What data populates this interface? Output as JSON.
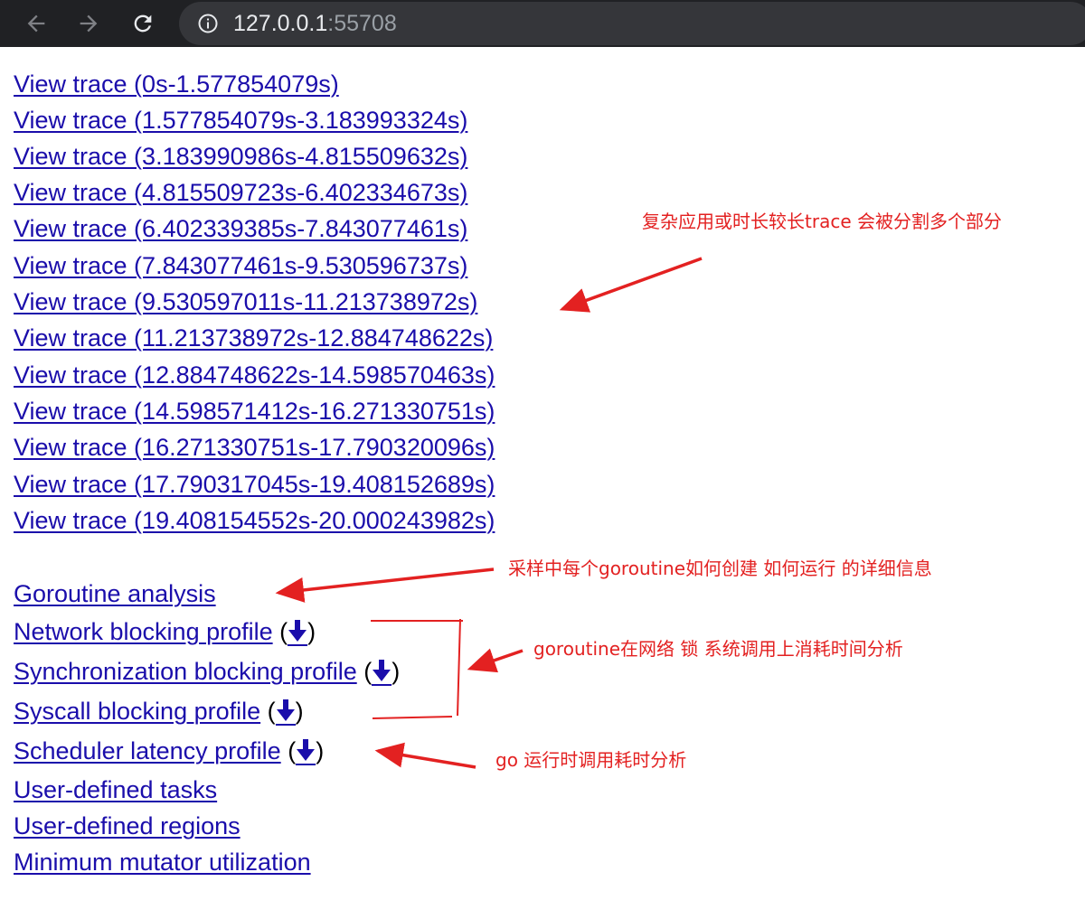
{
  "browser": {
    "url_host": "127.0.0.1",
    "url_port": ":55708",
    "icons": {
      "back": "arrow-left-icon",
      "forward": "arrow-right-icon",
      "reload": "reload-icon",
      "info": "info-icon"
    }
  },
  "trace_links": [
    "View trace (0s-1.577854079s)",
    "View trace (1.577854079s-3.183993324s)",
    "View trace (3.183990986s-4.815509632s)",
    "View trace (4.815509723s-6.402334673s)",
    "View trace (6.402339385s-7.843077461s)",
    "View trace (7.843077461s-9.530596737s)",
    "View trace (9.530597011s-11.213738972s)",
    "View trace (11.213738972s-12.884748622s)",
    "View trace (12.884748622s-14.598570463s)",
    "View trace (14.598571412s-16.271330751s)",
    "View trace (16.271330751s-17.790320096s)",
    "View trace (17.790317045s-19.408152689s)",
    "View trace (19.408154552s-20.000243982s)"
  ],
  "analysis_links": {
    "goroutine_analysis": "Goroutine analysis",
    "network_blocking": "Network blocking profile",
    "sync_blocking": "Synchronization blocking profile",
    "syscall_blocking": "Syscall blocking profile",
    "scheduler_latency": "Scheduler latency profile",
    "user_tasks": "User-defined tasks",
    "user_regions": "User-defined regions",
    "mmu": "Minimum mutator utilization",
    "paren_open": "(",
    "paren_close": ")"
  },
  "annotations": {
    "trace_split": "复杂应用或时长较长trace 会被分割多个部分",
    "goroutine": "采样中每个goroutine如何创建 如何运行 的详细信息",
    "blocking": "goroutine在网络 锁 系统调用上消耗时间分析",
    "scheduler": "go 运行时调用耗时分析"
  },
  "colors": {
    "link": "#1a0dab",
    "annotation": "#e32121",
    "toolbar": "#202124",
    "omnibox": "#35363a"
  }
}
